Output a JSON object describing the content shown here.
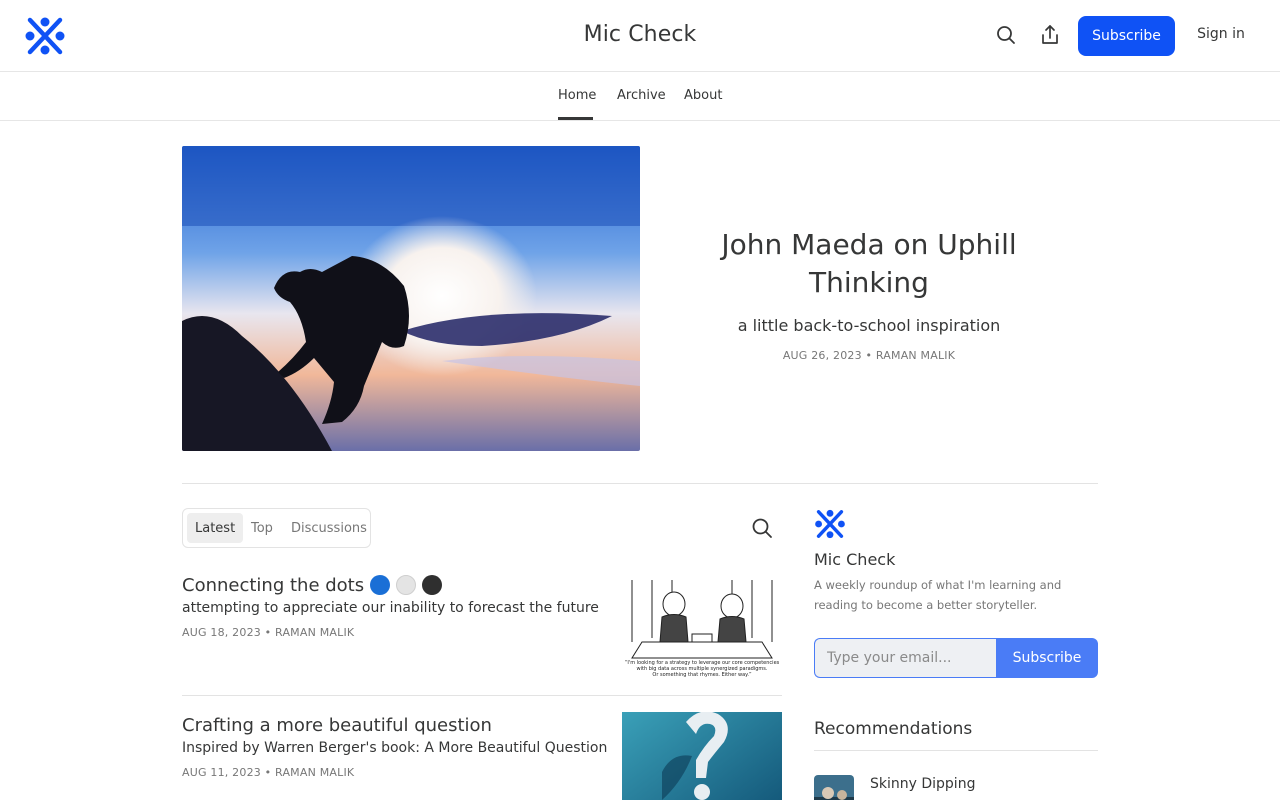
{
  "header": {
    "title": "Mic Check",
    "subscribe_label": "Subscribe",
    "signin_label": "Sign in",
    "brand_color": "#0f52f5"
  },
  "nav": {
    "tabs": [
      {
        "label": "Home",
        "active": true
      },
      {
        "label": "Archive",
        "active": false
      },
      {
        "label": "About",
        "active": false
      }
    ]
  },
  "hero": {
    "title": "John Maeda on Uphill Thinking",
    "subtitle": "a little back-to-school inspiration",
    "meta": "AUG 26, 2023 • RAMAN MALIK"
  },
  "feed": {
    "filters": [
      {
        "label": "Latest",
        "active": true
      },
      {
        "label": "Top",
        "active": false
      },
      {
        "label": "Discussions",
        "active": false
      }
    ],
    "posts": [
      {
        "title": "Connecting the dots",
        "title_dots": [
          "#1a6fd6",
          "#e6e6e6",
          "#2f2f2f"
        ],
        "subtitle": "attempting to appreciate our inability to forecast the future",
        "meta": "AUG 18, 2023 • RAMAN MALIK",
        "thumb_caption": "\"I'm looking for a strategy to leverage our core competencies with big data across multiple synergized paradigms. Or something that rhymes. Either way.\""
      },
      {
        "title": "Crafting a more beautiful question",
        "subtitle": "Inspired by Warren Berger's book: A More Beautiful Question",
        "meta": "AUG 11, 2023 • RAMAN MALIK"
      }
    ]
  },
  "sidebar": {
    "title": "Mic Check",
    "description": "A weekly roundup of what I'm learning and reading to become a better storyteller.",
    "email_placeholder": "Type your email...",
    "subscribe_label": "Subscribe",
    "recommendations_heading": "Recommendations",
    "recommendations": [
      {
        "name": "Skinny Dipping"
      }
    ]
  }
}
